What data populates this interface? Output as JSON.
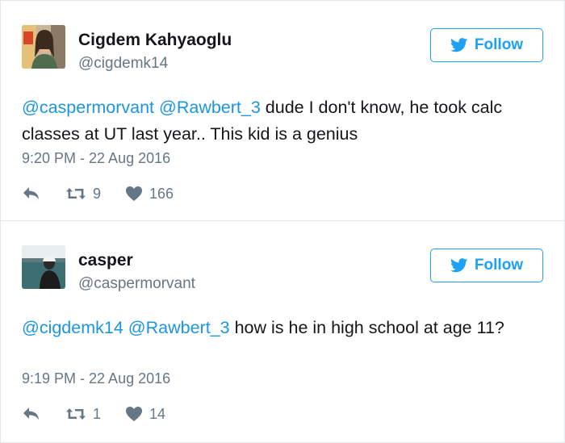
{
  "tweets": [
    {
      "display_name": "Cigdem Kahyaoglu",
      "handle": "@cigdemk14",
      "follow_label": "Follow",
      "text_parts": [
        {
          "text": "@caspermorvant",
          "mention": true
        },
        {
          "text": " ",
          "mention": false
        },
        {
          "text": "@Rawbert_3",
          "mention": true
        },
        {
          "text": " dude I don't know, he took calc classes at UT last year.. This kid is a genius",
          "mention": false
        }
      ],
      "timestamp": "9:20 PM - 22 Aug 2016",
      "retweets": "9",
      "likes": "166"
    },
    {
      "display_name": "casper",
      "handle": "@caspermorvant",
      "follow_label": "Follow",
      "text_parts": [
        {
          "text": "@cigdemk14",
          "mention": true
        },
        {
          "text": " ",
          "mention": false
        },
        {
          "text": "@Rawbert_3",
          "mention": true
        },
        {
          "text": " how is he in high school at age 11?",
          "mention": false
        }
      ],
      "timestamp": "9:19 PM - 22 Aug 2016",
      "retweets": "1",
      "likes": "14"
    }
  ],
  "icons": {
    "brand": "bird-icon",
    "reply": "reply-icon",
    "retweet": "retweet-icon",
    "like": "heart-icon"
  },
  "colors": {
    "accent": "#1da1f2",
    "mention": "#1b95e0",
    "muted": "#657786",
    "text": "#14171a",
    "divider_bg": "#f5f8fa"
  }
}
